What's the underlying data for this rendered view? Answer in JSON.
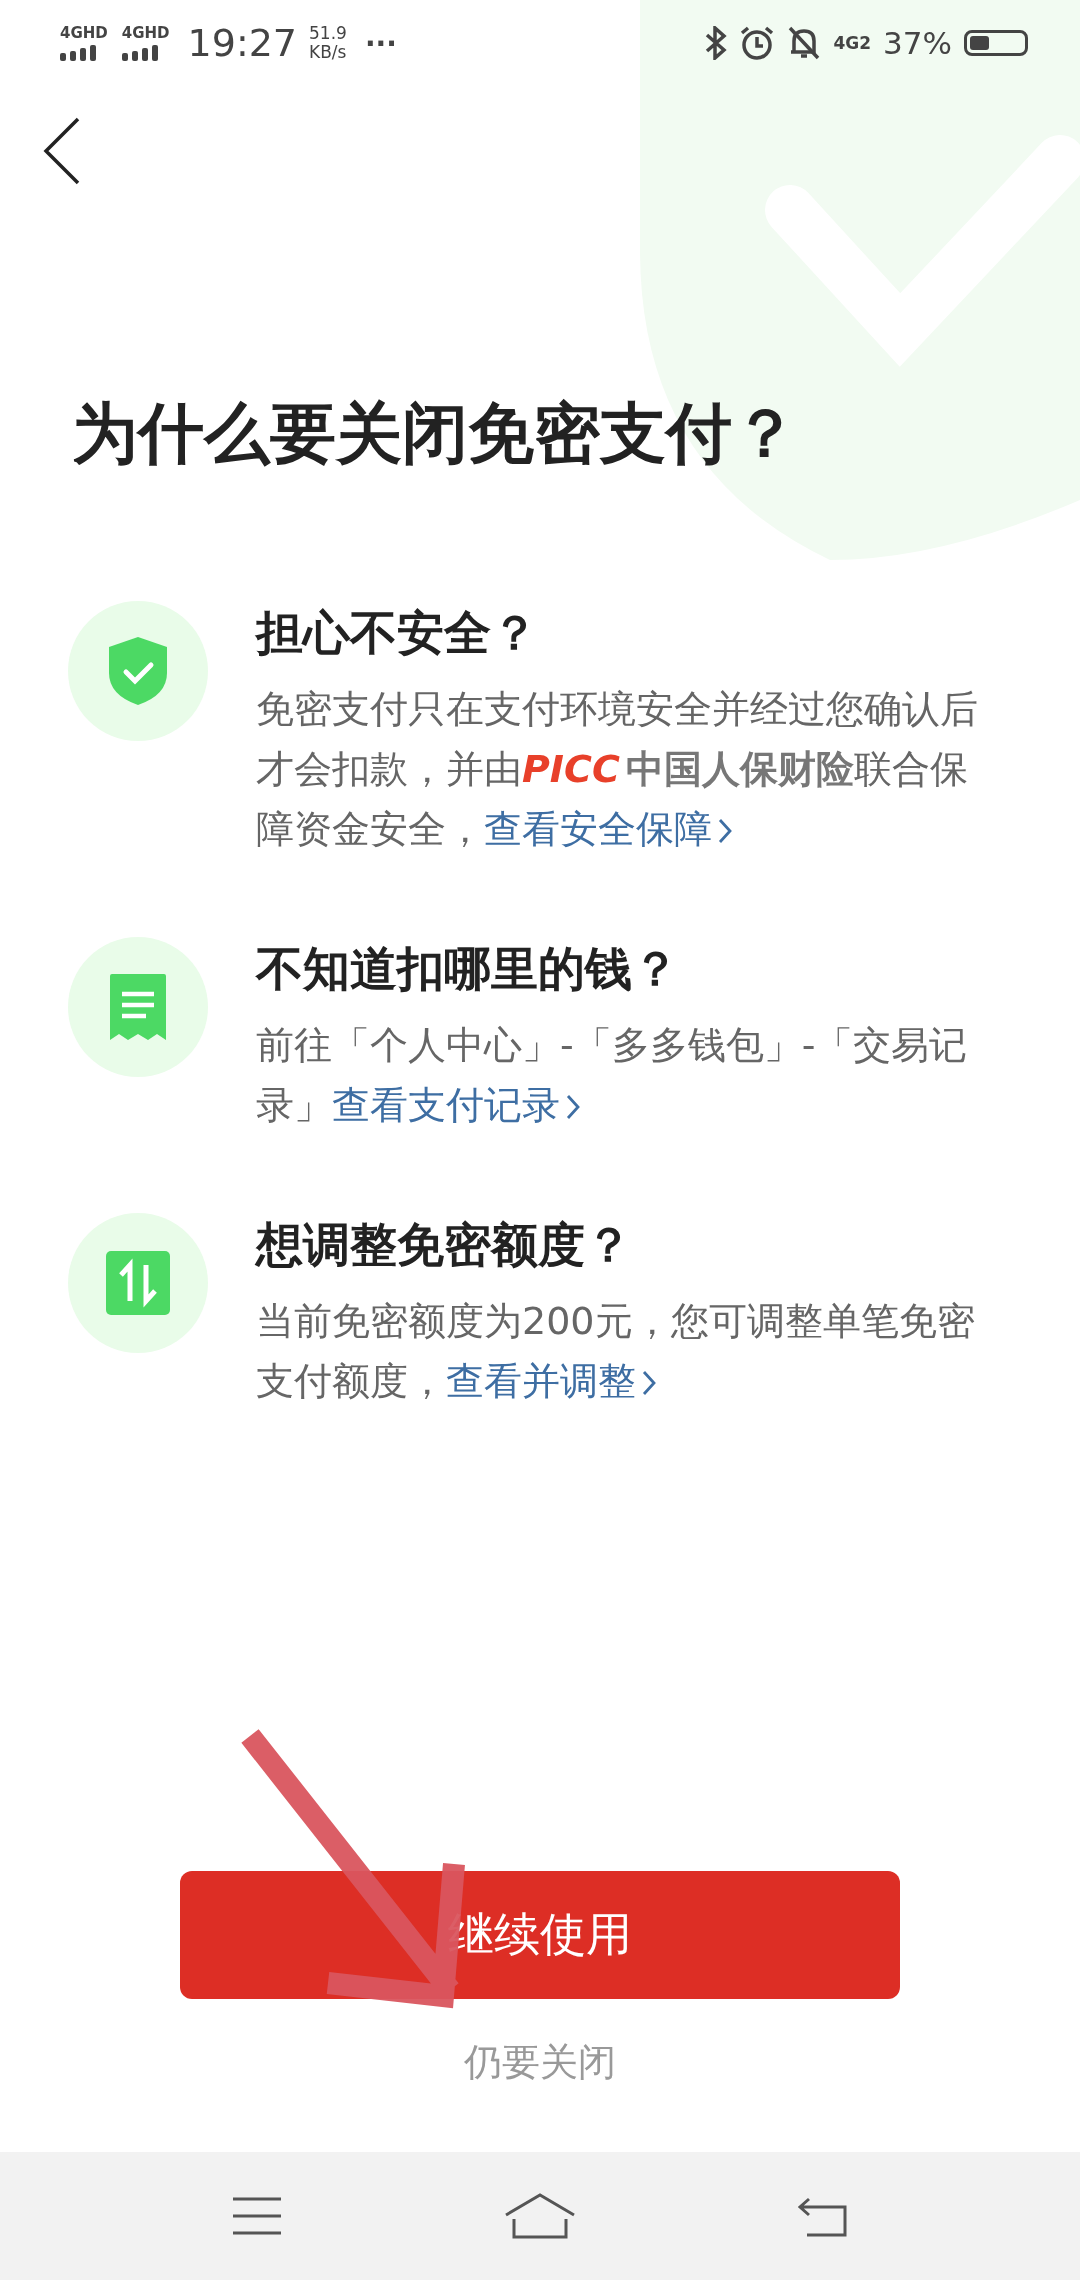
{
  "status_bar": {
    "signal_labels": [
      "4GHD",
      "4GHD"
    ],
    "time": "19:27",
    "speed": "51.9",
    "speed_unit": "KB/s",
    "more": "···",
    "network": "4G2",
    "battery": "37%"
  },
  "title": "为什么要关闭免密支付？",
  "items": [
    {
      "kind": "shield",
      "title": "担心不安全？",
      "segments": [
        {
          "kind": "text",
          "text": "免密支付只在支付环境安全并经过您确认后才会扣款，并由"
        },
        {
          "kind": "logo",
          "mark": "PICC",
          "name": "中国人保财险"
        },
        {
          "kind": "text",
          "text": "联合保障资金安全，"
        },
        {
          "kind": "link",
          "text": "查看安全保障"
        }
      ]
    },
    {
      "kind": "receipt",
      "title": "不知道扣哪里的钱？",
      "segments": [
        {
          "kind": "text",
          "text": "前往「个人中心」-「多多钱包」-「交易记录」"
        },
        {
          "kind": "link",
          "text": "查看支付记录"
        }
      ]
    },
    {
      "kind": "adjust",
      "title": "想调整免密额度？",
      "segments": [
        {
          "kind": "text",
          "text": "当前免密额度为200元，您可调整单笔免密支付额度，"
        },
        {
          "kind": "link",
          "text": "查看并调整"
        }
      ]
    }
  ],
  "primary_button": "继续使用",
  "secondary_button": "仍要关闭"
}
